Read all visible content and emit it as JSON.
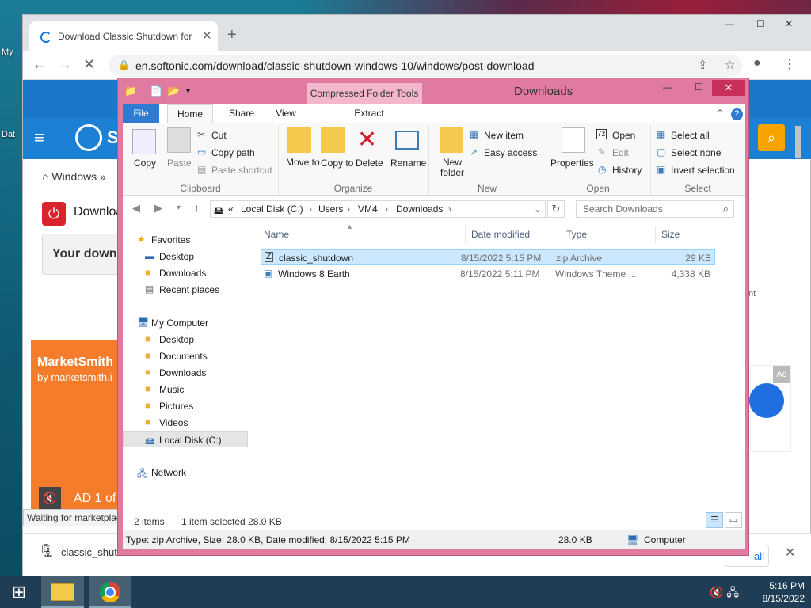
{
  "desktop": {
    "icon_labels": [
      "My",
      "Dat"
    ],
    "colors": {
      "accent": "#1a77c9",
      "explorer_border": "#e07aa0",
      "selection": "#cce8ff"
    }
  },
  "browser": {
    "tab_title": "Download Classic Shutdown for Windows",
    "new_tab": "+",
    "url": "en.softonic.com/download/classic-shutdown-windows-10/windows/post-download",
    "page": {
      "breadcrumb": "Windows »",
      "download_heading": "Downloa",
      "your_download": "Your down",
      "advertisement": "rtisement",
      "ad_title": "MarketSmith",
      "ad_subtitle": "by marketsmith.i",
      "ad_counter": "AD 1 of",
      "ad_tag": "Ad",
      "status_text": "Waiting for marketplace"
    },
    "shelf": {
      "file_name": "classic_shutdown",
      "show_all": "all"
    }
  },
  "explorer": {
    "title": "Downloads",
    "context_tab": "Compressed Folder Tools",
    "tabs": {
      "file": "File",
      "home": "Home",
      "share": "Share",
      "view": "View",
      "extract": "Extract"
    },
    "ribbon": {
      "clipboard": {
        "group": "Clipboard",
        "copy": "Copy",
        "paste": "Paste",
        "cut": "Cut",
        "copy_path": "Copy path",
        "paste_shortcut": "Paste shortcut"
      },
      "organize": {
        "group": "Organize",
        "move_to": "Move to",
        "copy_to": "Copy to",
        "delete": "Delete",
        "rename": "Rename"
      },
      "new": {
        "group": "New",
        "new_folder": "New folder",
        "new_item": "New item",
        "easy_access": "Easy access"
      },
      "open": {
        "group": "Open",
        "properties": "Properties",
        "open": "Open",
        "edit": "Edit",
        "history": "History"
      },
      "select": {
        "group": "Select",
        "select_all": "Select all",
        "select_none": "Select none",
        "invert_selection": "Invert selection"
      }
    },
    "address": {
      "prefix": "«",
      "parts": [
        "Local Disk (C:)",
        "Users",
        "VM4",
        "Downloads"
      ]
    },
    "search_placeholder": "Search Downloads",
    "nav": {
      "favorites": "Favorites",
      "fav_items": [
        "Desktop",
        "Downloads",
        "Recent places"
      ],
      "computer": "My Computer",
      "computer_items": [
        "Desktop",
        "Documents",
        "Downloads",
        "Music",
        "Pictures",
        "Videos",
        "Local Disk (C:)"
      ],
      "network": "Network"
    },
    "columns": {
      "name": "Name",
      "date": "Date modified",
      "type": "Type",
      "size": "Size"
    },
    "files": [
      {
        "name": "classic_shutdown",
        "date": "8/15/2022 5:15 PM",
        "type": "zip Archive",
        "size": "29 KB"
      },
      {
        "name": "Windows 8 Earth",
        "date": "8/15/2022 5:11 PM",
        "type": "Windows Theme ...",
        "size": "4,338 KB"
      }
    ],
    "status": {
      "count": "2 items",
      "selected": "1 item selected  28.0 KB"
    },
    "details": {
      "info": "Type: zip Archive, Size: 28.0 KB, Date modified: 8/15/2022 5:15 PM",
      "size": "28.0 KB",
      "location": "Computer"
    }
  },
  "taskbar": {
    "time": "5:16 PM",
    "date": "8/15/2022"
  }
}
